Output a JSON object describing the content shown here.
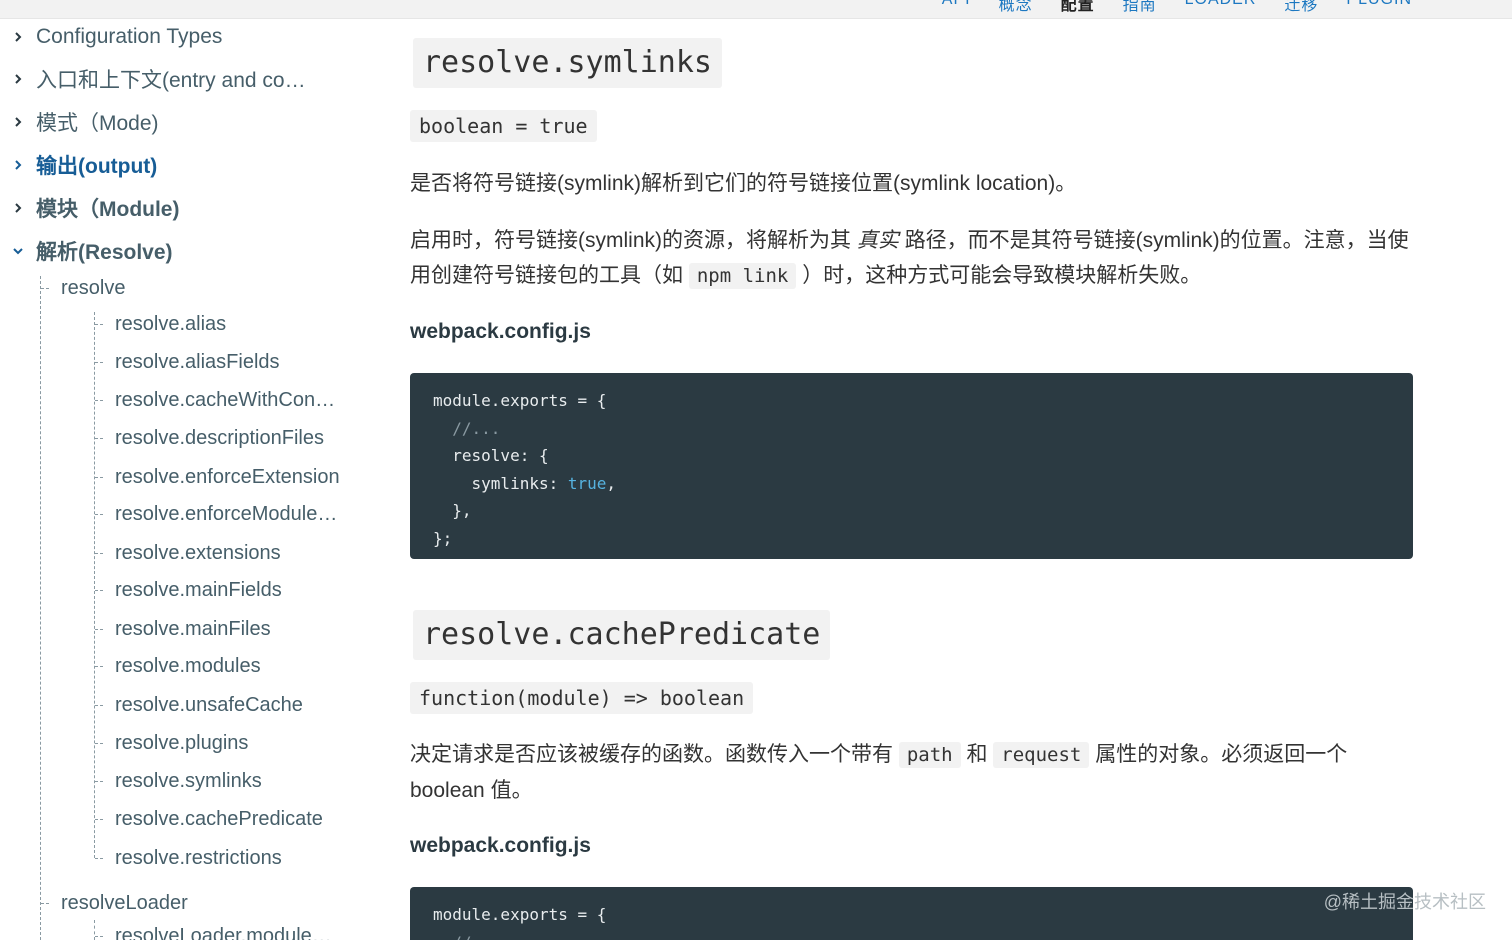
{
  "top_nav": {
    "items": [
      "API",
      "概念",
      "配置",
      "指南",
      "LOADER",
      "迁移",
      "PLUGIN"
    ],
    "active_index": 2
  },
  "sidebar": {
    "sections": [
      {
        "label": "Configuration Types",
        "expanded": false
      },
      {
        "label": "入口和上下文(entry and co…",
        "expanded": false
      },
      {
        "label": "模式（Mode)",
        "expanded": false
      },
      {
        "label": "输出(output)",
        "expanded": false,
        "active": true
      },
      {
        "label": "模块（Module)",
        "expanded": false
      },
      {
        "label": "解析(Resolve)",
        "expanded": true
      }
    ],
    "resolve_group": {
      "label": "resolve",
      "items": [
        "resolve.alias",
        "resolve.aliasFields",
        "resolve.cacheWithCon…",
        "resolve.descriptionFiles",
        "resolve.enforceExtension",
        "resolve.enforceModule…",
        "resolve.extensions",
        "resolve.mainFields",
        "resolve.mainFiles",
        "resolve.modules",
        "resolve.unsafeCache",
        "resolve.plugins",
        "resolve.symlinks",
        "resolve.cachePredicate",
        "resolve.restrictions"
      ]
    },
    "resolve_loader_group": {
      "label": "resolveLoader",
      "items": [
        "resolveLoader.module…"
      ]
    }
  },
  "content": {
    "symlinks": {
      "heading": "resolve.symlinks",
      "signature": "boolean = true",
      "desc1": "是否将符号链接(symlink)解析到它们的符号链接位置(symlink location)。",
      "desc2_a": "启用时，符号链接(symlink)的资源，将解析为其",
      "desc2_em": "真实",
      "desc2_b": "路径，而不是其符号链接(symlink)的位置。注意，当使用创建符号链接包的工具（如",
      "desc2_code": "npm link",
      "desc2_c": "）时，这种方式可能会导致模块解析失败。",
      "file_label": "webpack.config.js",
      "code": {
        "l1": "module.exports = {",
        "l2": "  //...",
        "l3": "  resolve: {",
        "l4_a": "    symlinks: ",
        "l4_kw": "true",
        "l4_b": ",",
        "l5": "  },",
        "l6": "};"
      }
    },
    "cache_predicate": {
      "heading": "resolve.cachePredicate",
      "signature": "function(module) => boolean",
      "desc_a": "决定请求是否应该被缓存的函数。函数传入一个带有",
      "desc_code1": "path",
      "desc_mid": "和",
      "desc_code2": "request",
      "desc_b": "属性的对象。必须返回一个 boolean 值。",
      "file_label": "webpack.config.js",
      "code": {
        "l1": "module.exports = {",
        "l2": "  //..."
      }
    }
  },
  "watermark": "@稀土掘金技术社区",
  "colors": {
    "link_blue": "#1d78c1",
    "active_section": "#175d96",
    "code_bg": "#2b3a42",
    "inline_code_bg": "#f2f2f2"
  }
}
